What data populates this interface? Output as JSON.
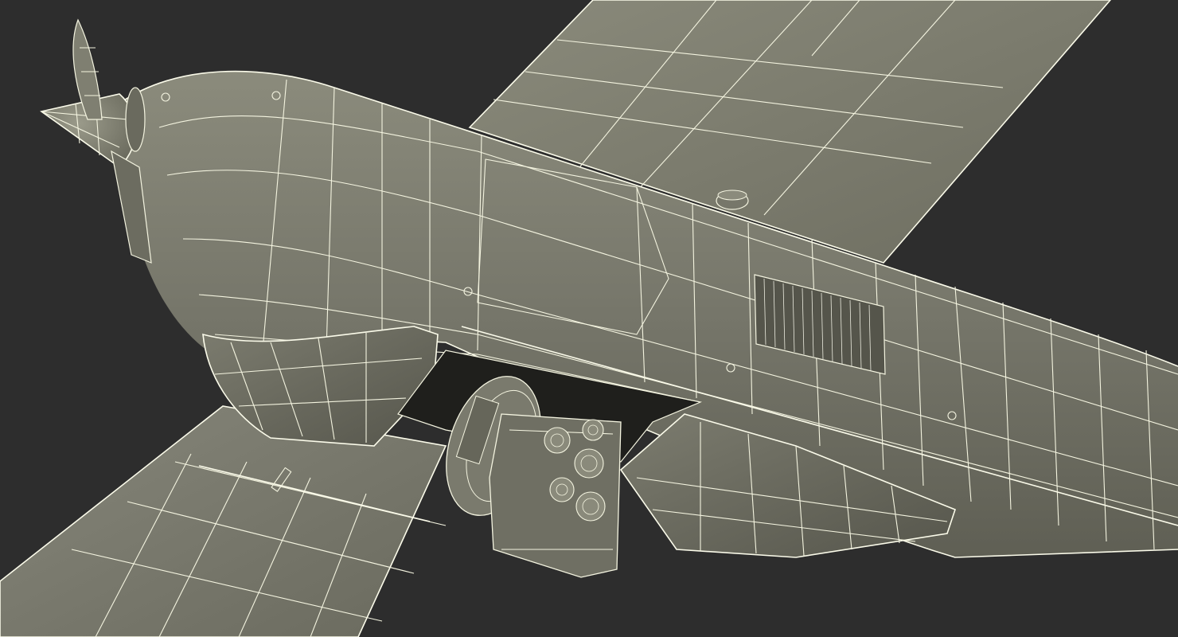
{
  "scene": {
    "subject": "",
    "background_color": "#2d2d2d",
    "surface_color": "#7a7a6c",
    "wire_color": "#f4f4e0"
  }
}
